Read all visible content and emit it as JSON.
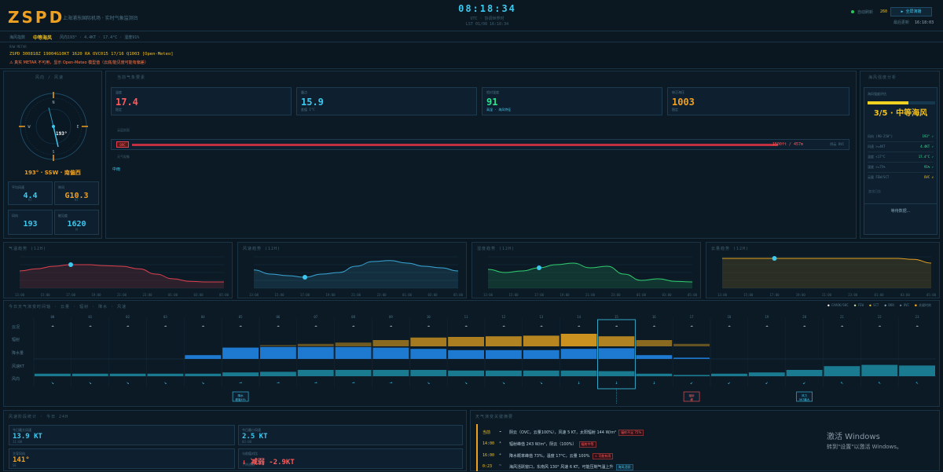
{
  "header": {
    "logo": "ZSPD",
    "subtitle": "上海浦东国际机场 · 实时气象监测台",
    "clock": "08:18:34",
    "utc_label": "UTC · 协调世界时",
    "lst_label": "LST 01/08 16:18:34",
    "auto_label": "自动刷新",
    "auto_value": "260",
    "fullscreen_label": "▶ 全屏演播",
    "last_update_label": "最后更新",
    "last_update_value": "16:18:03"
  },
  "infobar": {
    "label": "海风指数",
    "value": "中等海风",
    "detail": "风向193° · 4.4KT · 17.4°C · 湿度91%"
  },
  "metar": {
    "label": "RAW METAR",
    "text": "ZSPD 300818Z 19004G10KT 1620 RA OVC015 17/16 Q1003 [Open-Meteo]",
    "warning": "⚠ 真实 METAR 不可用，显示 Open-Meteo 模型值（云底/能见度可能有偏差）"
  },
  "wind_panel": {
    "title": "风向 / 风速",
    "dir_value": "193°",
    "compass_n": "N",
    "compass_e": "E",
    "compass_s": "S",
    "compass_w": "W",
    "summary": "193° · SSW · 南偏西",
    "cards": [
      {
        "label": "平均风速",
        "value": "4.4",
        "unit": "KT",
        "color": "#3ec8ee"
      },
      {
        "label": "阵风",
        "value": "G10.3",
        "unit": "KT",
        "color": "#f0a020"
      },
      {
        "label": "风向",
        "value": "193",
        "unit": "°",
        "color": "#3ec8ee"
      },
      {
        "label": "能见度",
        "value": "1620",
        "unit": "M",
        "color": "#3ec8ee"
      }
    ]
  },
  "weather_panel": {
    "title": "当前气象要素",
    "cards": [
      {
        "label": "温度",
        "value": "17.4",
        "sub": "稳定",
        "color": "#ff5a5a"
      },
      {
        "label": "露点",
        "value": "15.9",
        "sub": "差值 1°C",
        "color": "#3ec8ee"
      },
      {
        "label": "相对湿度",
        "value": "91",
        "sub": "高湿 · 海风特征",
        "color": "#30e090"
      },
      {
        "label": "修正海压",
        "value": "1003",
        "sub": "稳定",
        "color": "#f0a020"
      }
    ],
    "cloud_title": "云层剖面",
    "cloud_code": "OVC",
    "cloud_readout": "1500ft / 457m",
    "cloud_note": "阴云 OVC",
    "phen_title": "天气现象",
    "phen_value": "中雨"
  },
  "sea_breeze": {
    "title": "海风强度分析",
    "subtitle": "海风强度评估",
    "level_fraction": 0.6,
    "level_text": "3/5 · 中等海风",
    "rows": [
      {
        "label": "风向 (90-250°)",
        "value": "193° ✓"
      },
      {
        "label": "风速 >=4KT",
        "value": "4.4KT ✓"
      },
      {
        "label": "温度 <17°C",
        "value": "17.4°C ✓"
      },
      {
        "label": "湿度 >=75%",
        "value": "91% ✓"
      },
      {
        "label": "云量 FEW/SCT",
        "value": "OVC ✗"
      }
    ],
    "log_title": "变化日志",
    "log_text": "等待数据..."
  },
  "charts": [
    {
      "title": "气温趋势 (12H)",
      "color": "#e04050"
    },
    {
      "title": "风速趋势 (12H)",
      "color": "#3aa8d8"
    },
    {
      "title": "湿度趋势 (12H)",
      "color": "#30d070"
    },
    {
      "title": "云量趋势 (12H)",
      "color": "#e0a020"
    }
  ],
  "chart_hours": [
    "13:00",
    "15:00",
    "17:00",
    "19:00",
    "21:00",
    "23:00",
    "01:00",
    "03:00",
    "05:00"
  ],
  "timeline": {
    "title": "今日天气演变时间轴 · 云量 · 辐射 · 降水 · 风速",
    "legend": [
      "CAVOK/SKC",
      "FEW",
      "SCT",
      "BKN",
      "OVC",
      "关键时刻"
    ],
    "row_labels": [
      "云况",
      "辐射",
      "降水量",
      "风速KT",
      "风向"
    ],
    "hours": [
      "00",
      "01",
      "02",
      "03",
      "04",
      "05",
      "06",
      "07",
      "08",
      "09",
      "10",
      "11",
      "12",
      "13",
      "14",
      "15",
      "16",
      "17",
      "18",
      "19",
      "20",
      "21",
      "22",
      "23"
    ],
    "current_hour": "15",
    "callouts": [
      "降水\n峰值49%",
      "辐射\n峰",
      "风力\n5KT最大"
    ]
  },
  "wind_stats": {
    "title": "风速阶段统计 · 今日 24H",
    "cards": [
      {
        "label": "今日最大风速",
        "value": "13.9 KT",
        "sub": "11:00",
        "color": "#3ec8ee"
      },
      {
        "label": "今日最小风速",
        "value": "2.5 KT",
        "sub": "03:00",
        "color": "#3ec8ee"
      },
      {
        "label": "主导风向",
        "value": "141°",
        "sub": "SE",
        "color": "#f0a020"
      },
      {
        "label": "与前值对比",
        "value": "↓ 减弱 -2.9KT",
        "sub": "下降趋势",
        "color": "#ff5a5a"
      }
    ]
  },
  "events": {
    "title": "天气演变关键摘要",
    "items": [
      {
        "time": "当前",
        "icon": "☁",
        "text": "阴云（OVC，云量100%），风速 5 KT，太阳辐射 144 W/m²",
        "tag": "辐射不足 75%",
        "tag_color": "#ff5a5a"
      },
      {
        "time": "14:00",
        "icon": "☀",
        "text": "辐射峰值 243 W/m²，阴云（100%）",
        "tag": "辐射中等",
        "tag_color": "#ff5a5a"
      },
      {
        "time": "16:00",
        "icon": "☂",
        "text": "降水概率峰值 73%，温度 17°C，云量 100%",
        "tag": "⚠ 可能有雨",
        "tag_color": "#ff5a5a"
      },
      {
        "time": "0:23",
        "icon": "~",
        "text": "海风活跃窗口，东南风 130° 风速 6 KT，可能压制气温上升",
        "tag": "海风活跃",
        "tag_color": "#3ec8ee"
      }
    ]
  },
  "watermark": {
    "line1": "激活 Windows",
    "line2": "转到\"设置\"以激活 Windows。"
  }
}
